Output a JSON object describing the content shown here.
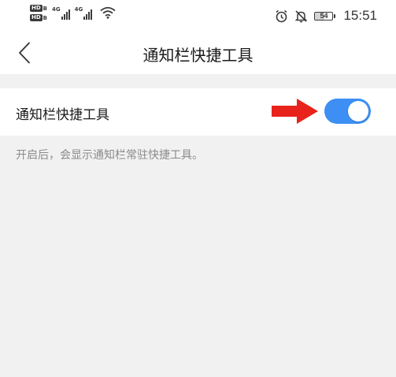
{
  "status_bar": {
    "hd_label": "HD",
    "hd_sub": "B",
    "network_1": "4G",
    "network_2": "4G",
    "battery_level": 54,
    "battery_text": "54",
    "time": "15:51"
  },
  "header": {
    "title": "通知栏快捷工具",
    "back_icon": "chevron-left-icon"
  },
  "setting": {
    "label": "通知栏快捷工具",
    "toggle_on": true,
    "toggle_color": "#3d8ff4",
    "annotation_color": "#e8231b"
  },
  "description": "开启后，会显示通知栏常驻快捷工具。"
}
